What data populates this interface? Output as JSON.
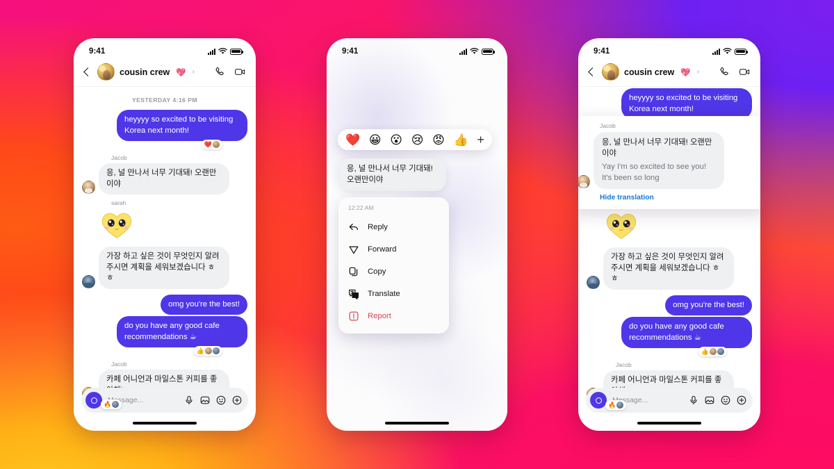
{
  "background": {
    "colors": [
      "#f5107e",
      "#fb1567",
      "#ff3a2d",
      "#ff6a12",
      "#ffae10",
      "#7b1ff0",
      "#ff0a62"
    ]
  },
  "status_bar": {
    "time": "9:41",
    "signal": "signal-icon",
    "wifi": "wifi-icon",
    "battery": "battery-icon"
  },
  "header": {
    "back": "back-icon",
    "title": "cousin crew",
    "title_emoji": "💖",
    "chevron": "›",
    "call": "phone-call-icon",
    "video": "video-call-icon"
  },
  "phone1": {
    "daystamp": "YESTERDAY 4:16 PM",
    "messages": [
      {
        "type": "out",
        "text": "heyyyy so excited to be visiting Korea next month!"
      },
      {
        "type": "reaction-out",
        "emoji": "❤️"
      },
      {
        "type": "sender",
        "name": "Jacob"
      },
      {
        "type": "in",
        "avatar": "jacob",
        "text": "응, 널 만나서 너무 기대돼! 오랜만이야"
      },
      {
        "type": "sender",
        "name": "sarah"
      },
      {
        "type": "sticker",
        "name": "yellow-heart-sticker"
      },
      {
        "type": "in",
        "avatar": "sarah",
        "text": "가장 하고 싶은 것이 무엇인지 알려주시면 계획을 세워보겠습니다 ㅎㅎ"
      },
      {
        "type": "out",
        "text": "omg you're the best!"
      },
      {
        "type": "out",
        "text": "do you have any good cafe recommendations ☕"
      },
      {
        "type": "reaction-out",
        "emoji": "👍"
      },
      {
        "type": "sender",
        "name": "Jacob"
      },
      {
        "type": "in",
        "avatar": "jacob",
        "text": "카페 어니언과 마일스톤 커피를 좋아해!"
      },
      {
        "type": "reaction-in",
        "emoji": "🔥"
      }
    ]
  },
  "phone2": {
    "emoji_bar": [
      "❤️",
      "😀",
      "😮",
      "😢",
      "😡",
      "👍"
    ],
    "emoji_bar_add": "+",
    "focused_message": "응, 널 만나서 너무 기대돼! 오랜만이야",
    "context_menu": {
      "time": "12:22 AM",
      "items": [
        {
          "label": "Reply",
          "icon": "reply-icon"
        },
        {
          "label": "Forward",
          "icon": "forward-icon"
        },
        {
          "label": "Copy",
          "icon": "copy-icon"
        },
        {
          "label": "Translate",
          "icon": "translate-icon"
        },
        {
          "label": "Report",
          "icon": "report-icon"
        }
      ]
    }
  },
  "phone3": {
    "messages": [
      {
        "type": "out",
        "text": "heyyyy so excited to be visiting Korea next month!"
      },
      {
        "type": "reaction-out",
        "emoji": "❤️"
      }
    ],
    "translation_card": {
      "sender": "Jacob",
      "original": "응, 널 만나서 너무 기대돼! 오랜만이야",
      "translated": "Yay I'm so excited to see you! It's been so long",
      "hide_label": "Hide translation",
      "link_color": "#1877d2"
    },
    "after": [
      {
        "type": "sticker",
        "name": "yellow-heart-sticker"
      },
      {
        "type": "in",
        "avatar": "sarah",
        "text": "가장 하고 싶은 것이 무엇인지 알려주시면 계획을 세워보겠습니다 ㅎㅎ"
      },
      {
        "type": "out",
        "text": "omg you're the best!"
      },
      {
        "type": "out",
        "text": "do you have any good cafe recommendations ☕"
      },
      {
        "type": "reaction-out",
        "emoji": "👍"
      },
      {
        "type": "sender",
        "name": "Jacob"
      },
      {
        "type": "in",
        "avatar": "jacob",
        "text": "카페 어니언과 마일스톤 커피를 좋아해!"
      },
      {
        "type": "reaction-in",
        "emoji": "🔥"
      }
    ]
  },
  "composer": {
    "camera": "camera-icon",
    "placeholder": "Message...",
    "mic": "mic-icon",
    "gallery": "gallery-icon",
    "sticker": "sticker-icon",
    "plus": "plus-circle-icon",
    "accent": "#4f36e8"
  },
  "bubbles": {
    "outgoing_color": "#4f36e8",
    "incoming_color": "#eff0f2"
  }
}
